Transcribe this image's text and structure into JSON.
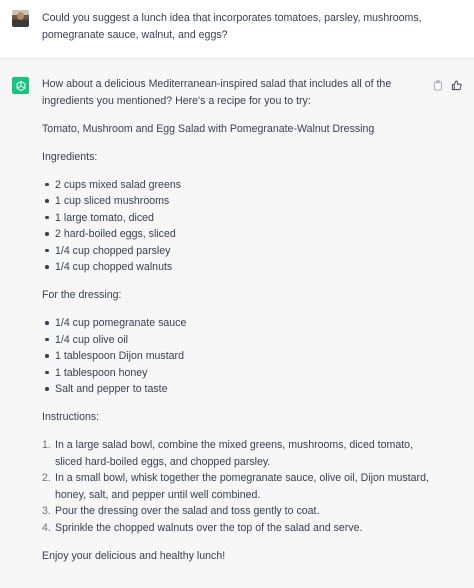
{
  "user_message": "Could you suggest a lunch idea that incorporates tomatoes, parsley, mushrooms, pomegranate sauce, walnut, and eggs?",
  "assistant": {
    "intro": "How about a delicious Mediterranean-inspired salad that includes all of the ingredients you mentioned? Here's a recipe for you to try:",
    "recipe_title": "Tomato, Mushroom and Egg Salad with Pomegranate-Walnut Dressing",
    "ingredients_heading": "Ingredients:",
    "ingredients": [
      "2 cups mixed salad greens",
      "1 cup sliced mushrooms",
      "1 large tomato, diced",
      "2 hard-boiled eggs, sliced",
      "1/4 cup chopped parsley",
      "1/4 cup chopped walnuts"
    ],
    "dressing_heading": "For the dressing:",
    "dressing": [
      "1/4 cup pomegranate sauce",
      "1/4 cup olive oil",
      "1 tablespoon Dijon mustard",
      "1 tablespoon honey",
      "Salt and pepper to taste"
    ],
    "instructions_heading": "Instructions:",
    "instructions": [
      {
        "num": "1.",
        "text": "In a large salad bowl, combine the mixed greens, mushrooms, diced tomato, sliced hard-boiled eggs, and chopped parsley."
      },
      {
        "num": "2.",
        "text": "In a small bowl, whisk together the pomegranate sauce, olive oil, Dijon mustard, honey, salt, and pepper until well combined."
      },
      {
        "num": "3.",
        "text": "Pour the dressing over the salad and toss gently to coat."
      },
      {
        "num": "4.",
        "text": "Sprinkle the chopped walnuts over the top of the salad and serve."
      }
    ],
    "closing": "Enjoy your delicious and healthy lunch!"
  },
  "icons": {
    "user_avatar": "user-avatar",
    "assistant_avatar": "openai-logo-icon",
    "copy": "clipboard-icon",
    "like": "thumbs-up-icon"
  },
  "colors": {
    "assistant_bg": "#f7f7f8",
    "avatar_green": "#19c37d",
    "text": "#374151"
  }
}
